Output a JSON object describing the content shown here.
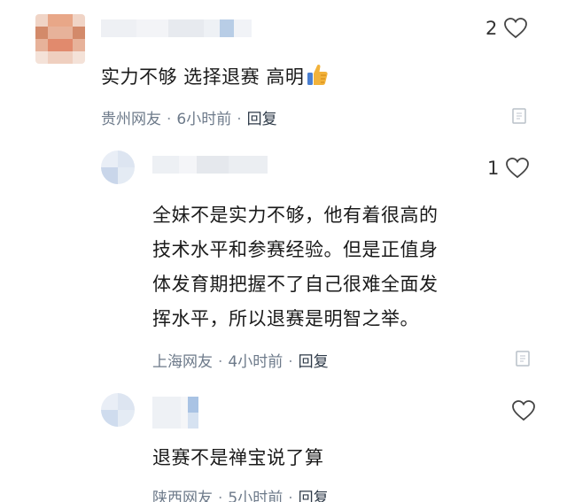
{
  "comments": [
    {
      "text": "实力不够 选择退赛 高明",
      "location": "贵州网友",
      "time": "6小时前",
      "reply_label": "回复",
      "likes": "2",
      "emoji": "thumbs-up-icon"
    },
    {
      "text_lines": [
        "全妹不是实力不够，他有着很高的",
        "技术水平和参赛经验。但是正值身",
        "体发育期把握不了自己很难全面发",
        "挥水平，所以退赛是明智之举。"
      ],
      "location": "上海网友",
      "time": "4小时前",
      "reply_label": "回复",
      "likes": "1"
    },
    {
      "text": "退赛不是禅宝说了算",
      "location": "陕西网友",
      "time": "5小时前",
      "reply_label": "回复",
      "likes": ""
    }
  ],
  "separator": "·",
  "colors": {
    "meta": "#6d7a8a",
    "text": "#1a1a1a",
    "thumb": "#f2b23a"
  }
}
